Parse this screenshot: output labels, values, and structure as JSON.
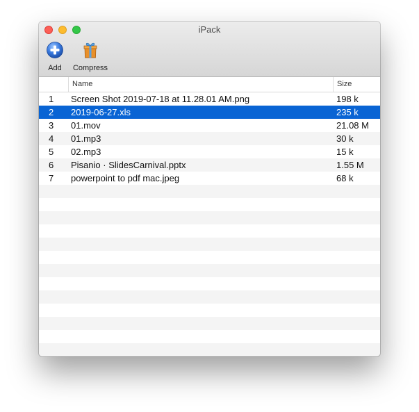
{
  "window": {
    "title": "iPack"
  },
  "toolbar": {
    "add_label": "Add",
    "compress_label": "Compress"
  },
  "table": {
    "columns": [
      "",
      "Name",
      "Size"
    ],
    "rows": [
      {
        "index": "1",
        "name": "Screen Shot 2019-07-18 at 11.28.01 AM.png",
        "size": "198 k"
      },
      {
        "index": "2",
        "name": "2019-06-27.xls",
        "size": "235 k"
      },
      {
        "index": "3",
        "name": "01.mov",
        "size": "21.08 M"
      },
      {
        "index": "4",
        "name": "01.mp3",
        "size": "30 k"
      },
      {
        "index": "5",
        "name": "02.mp3",
        "size": "15 k"
      },
      {
        "index": "6",
        "name": "Pisanio · SlidesCarnival.pptx",
        "size": "1.55 M"
      },
      {
        "index": "7",
        "name": "powerpoint to pdf mac.jpeg",
        "size": "68 k"
      }
    ],
    "selected_row": 2
  },
  "colors": {
    "selection": "#0964d4",
    "stripe": "#f4f4f4",
    "add_icon": "#3a7be0",
    "compress_icon": "#e8902a"
  },
  "icons": {
    "add": "add-plus-circle-icon",
    "compress": "gift-box-icon"
  }
}
